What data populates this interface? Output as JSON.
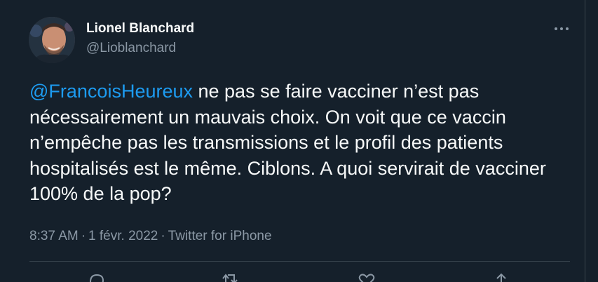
{
  "tweet": {
    "author_name": "Lionel Blanchard",
    "author_handle": "@Lioblanchard",
    "mention": "@FrancoisHeureux",
    "text": " ne pas se faire vacciner n’est pas nécessairement un mauvais choix. On voit que ce vaccin n’empêche pas les transmissions et le profil des patients hospitalisés est le même. Ciblons. A quoi servirait de vacciner 100% de la pop?",
    "time": "8:37 AM",
    "date": "1 févr. 2022",
    "source": "Twitter for iPhone",
    "separator": "·"
  },
  "icons": {
    "more": "more-horizontal-icon",
    "reply": "reply-icon",
    "retweet": "retweet-icon",
    "like": "heart-icon",
    "share": "share-icon"
  },
  "colors": {
    "background": "#15202b",
    "text": "#f7f9f9",
    "secondary": "#8b98a5",
    "accent": "#1d9bf0",
    "divider": "#38444d"
  }
}
